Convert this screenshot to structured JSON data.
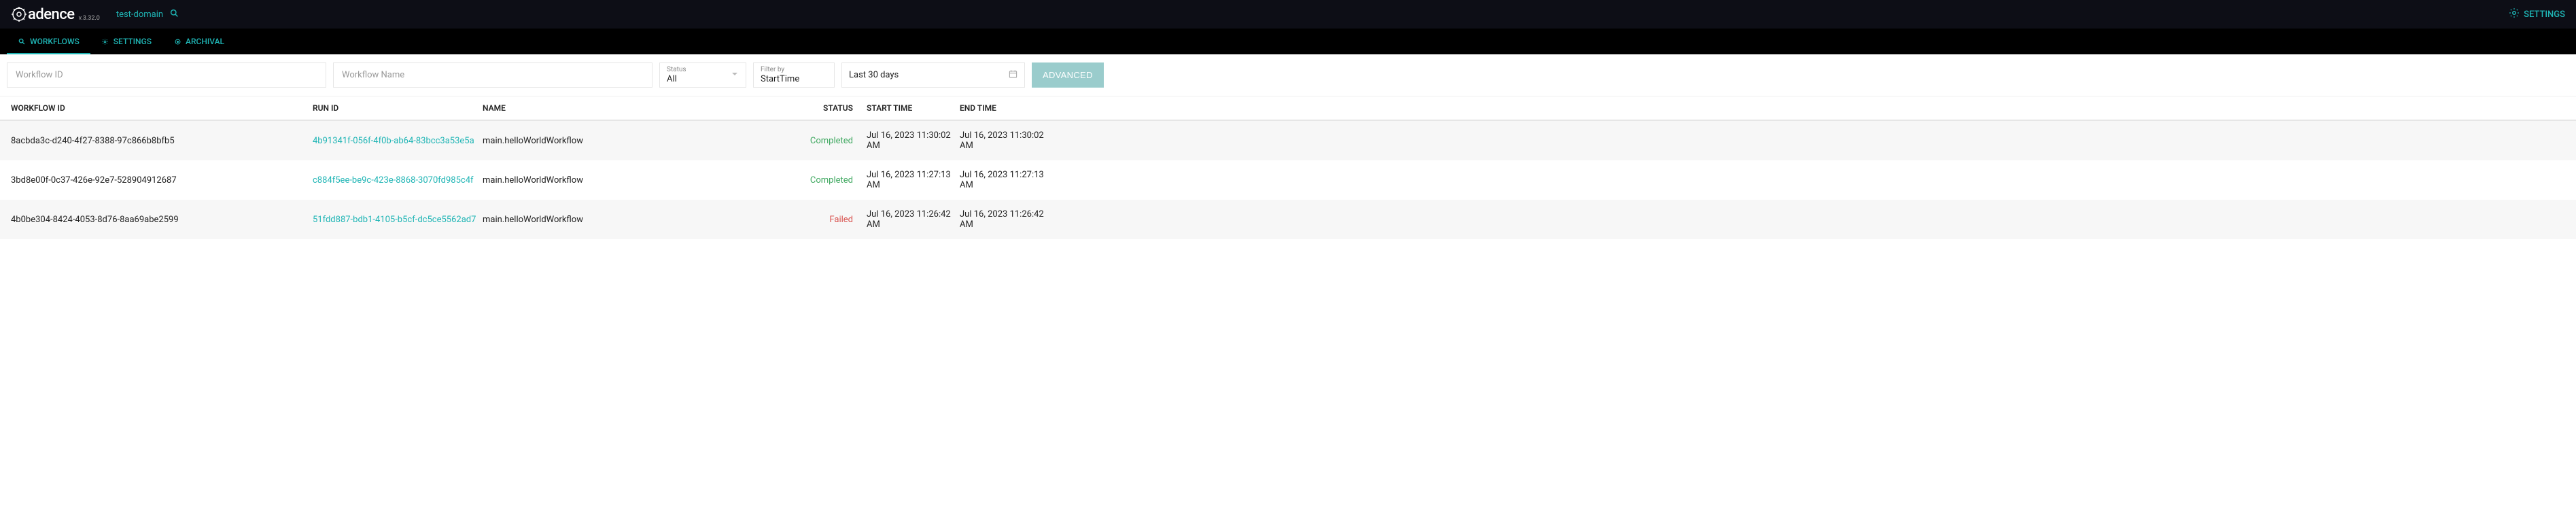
{
  "header": {
    "product_name": "adence",
    "version": "v.3.32.0",
    "domain": "test-domain",
    "settings_label": "SETTINGS"
  },
  "nav": {
    "items": [
      {
        "label": "WORKFLOWS",
        "icon": "search"
      },
      {
        "label": "SETTINGS",
        "icon": "gear"
      },
      {
        "label": "ARCHIVAL",
        "icon": "target"
      }
    ]
  },
  "filters": {
    "workflow_id_placeholder": "Workflow ID",
    "workflow_name_placeholder": "Workflow Name",
    "status_label": "Status",
    "status_value": "All",
    "filterby_label": "Filter by",
    "filterby_value": "StartTime",
    "daterange_value": "Last 30 days",
    "advanced_label": "ADVANCED"
  },
  "columns": {
    "workflow_id": "WORKFLOW ID",
    "run_id": "RUN ID",
    "name": "NAME",
    "status": "STATUS",
    "start_time": "START TIME",
    "end_time": "END TIME"
  },
  "rows": [
    {
      "workflow_id": "8acbda3c-d240-4f27-8388-97c866b8bfb5",
      "run_id": "4b91341f-056f-4f0b-ab64-83bcc3a53e5a",
      "name": "main.helloWorldWorkflow",
      "status": "Completed",
      "status_kind": "completed",
      "start_time": "Jul 16, 2023 11:30:02 AM",
      "end_time": "Jul 16, 2023 11:30:02 AM"
    },
    {
      "workflow_id": "3bd8e00f-0c37-426e-92e7-528904912687",
      "run_id": "c884f5ee-be9c-423e-8868-3070fd985c4f",
      "name": "main.helloWorldWorkflow",
      "status": "Completed",
      "status_kind": "completed",
      "start_time": "Jul 16, 2023 11:27:13 AM",
      "end_time": "Jul 16, 2023 11:27:13 AM"
    },
    {
      "workflow_id": "4b0be304-8424-4053-8d76-8aa69abe2599",
      "run_id": "51fdd887-bdb1-4105-b5cf-dc5ce5562ad7",
      "name": "main.helloWorldWorkflow",
      "status": "Failed",
      "status_kind": "failed",
      "start_time": "Jul 16, 2023 11:26:42 AM",
      "end_time": "Jul 16, 2023 11:26:42 AM"
    }
  ]
}
